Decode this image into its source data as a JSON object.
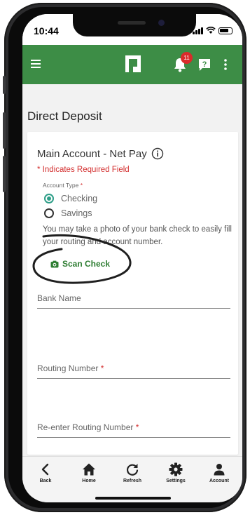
{
  "status_bar": {
    "time": "10:44"
  },
  "app_bar": {
    "menu_icon": "hamburger-icon",
    "logo_icon": "app-logo-icon",
    "notification_icon": "bell-icon",
    "notification_count": "11",
    "help_icon": "help-icon",
    "more_icon": "kebab-menu-icon",
    "colors": {
      "bar": "#3d8d46",
      "badge": "#d92b2b"
    }
  },
  "page": {
    "title": "Direct Deposit"
  },
  "form": {
    "title": "Main Account - Net Pay",
    "required_note": "* Indicates Required Field",
    "account_type_label": "Account Type",
    "required_mark": "*",
    "options": [
      {
        "label": "Checking",
        "selected": true
      },
      {
        "label": "Savings",
        "selected": false
      }
    ],
    "hint": "You may take a photo of your bank check to easily fill your routing and account number.",
    "scan_button": "Scan Check",
    "fields": [
      {
        "label": "Bank Name",
        "required": false
      },
      {
        "label": "Routing Number",
        "required": true
      },
      {
        "label": "Re-enter Routing Number",
        "required": true
      }
    ],
    "colors": {
      "accent": "#2e9e88",
      "required": "#d32f2f",
      "scan": "#2e7d32"
    }
  },
  "bottom_nav": {
    "items": [
      {
        "label": "Back",
        "icon": "chevron-left-icon"
      },
      {
        "label": "Home",
        "icon": "home-icon"
      },
      {
        "label": "Refresh",
        "icon": "refresh-icon"
      },
      {
        "label": "Settings",
        "icon": "gear-icon"
      },
      {
        "label": "Account",
        "icon": "person-icon"
      }
    ]
  }
}
